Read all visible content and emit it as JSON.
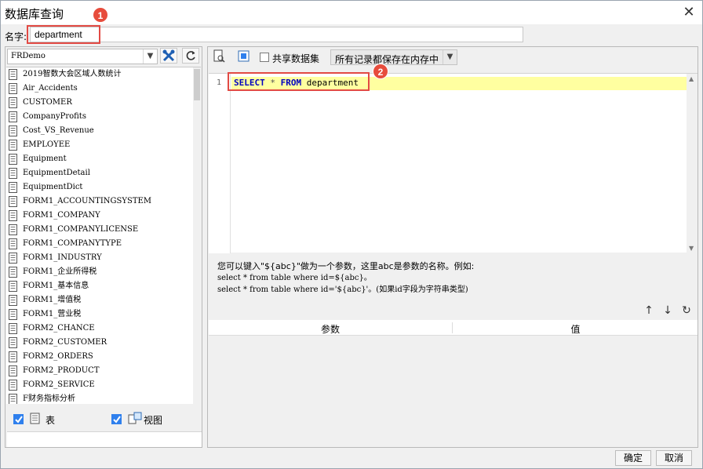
{
  "window": {
    "title": "数据库查询",
    "close_glyph": "✕"
  },
  "name_field": {
    "label": "名字:",
    "value": "department"
  },
  "badges": {
    "one": "1",
    "two": "2"
  },
  "datasource": {
    "selected": "FRDemo"
  },
  "tables": [
    "2019智数大会区域人数统计",
    "Air_Accidents",
    "CUSTOMER",
    "CompanyProfits",
    "Cost_VS_Revenue",
    "EMPLOYEE",
    "Equipment",
    "EquipmentDetail",
    "EquipmentDict",
    "FORM1_ACCOUNTINGSYSTEM",
    "FORM1_COMPANY",
    "FORM1_COMPANYLICENSE",
    "FORM1_COMPANYTYPE",
    "FORM1_INDUSTRY",
    "FORM1_企业所得税",
    "FORM1_基本信息",
    "FORM1_增值税",
    "FORM1_营业税",
    "FORM2_CHANCE",
    "FORM2_CUSTOMER",
    "FORM2_ORDERS",
    "FORM2_PRODUCT",
    "FORM2_SERVICE",
    "F财务指标分析"
  ],
  "filters": {
    "table_label": "表",
    "view_label": "视图"
  },
  "toolbar": {
    "shared_label": "共享数据集",
    "mode_value": "所有记录都保存在内存中"
  },
  "editor": {
    "line_no": "1",
    "kw_select": "SELECT",
    "star": "*",
    "kw_from": "FROM",
    "table": "department"
  },
  "hint": {
    "line1": "您可以键入\"${abc}\"做为一个参数，这里abc是参数的名称。例如:",
    "line2": "select * from table where id=${abc}。",
    "line3": "select * from table where id='${abc}'。(如果id字段为字符串类型)"
  },
  "params": {
    "col_param": "参数",
    "col_value": "值",
    "up": "↑",
    "down": "↓",
    "refresh": "↻"
  },
  "buttons": {
    "ok": "确定",
    "cancel": "取消"
  },
  "colors": {
    "badge": "#e74c3c",
    "highlight": "#ffffa0",
    "keyword": "#0000c0",
    "checkbox": "#2f80ed"
  }
}
